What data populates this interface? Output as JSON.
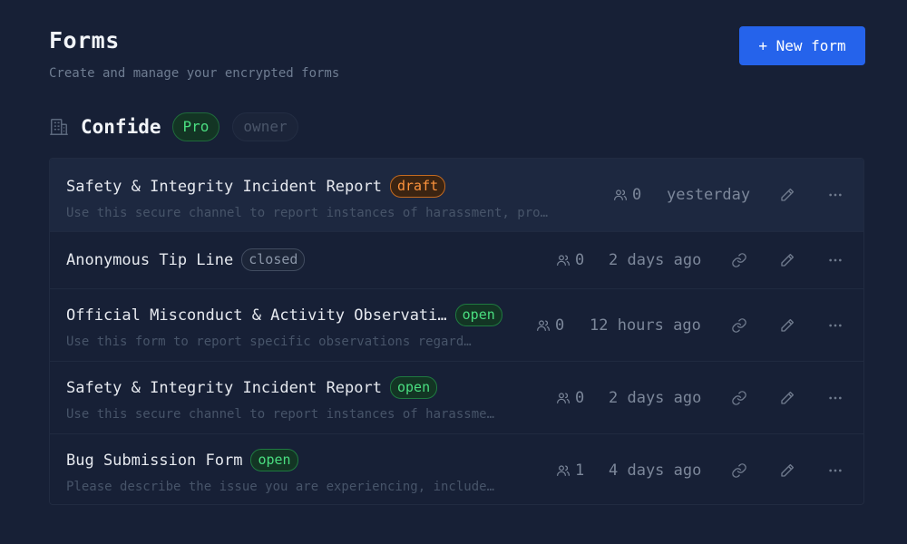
{
  "header": {
    "title": "Forms",
    "subtitle": "Create and manage your encrypted forms",
    "new_button_label": "+ New form"
  },
  "org": {
    "icon": "building-icon",
    "name": "Confide",
    "plan": "Pro",
    "role": "owner"
  },
  "forms": [
    {
      "title": "Safety & Integrity Incident Report",
      "status": "draft",
      "description": "Use this secure channel to report instances of harassment, pro…",
      "responses": "0",
      "updated": "yesterday"
    },
    {
      "title": "Anonymous Tip Line",
      "status": "closed",
      "description": "",
      "responses": "0",
      "updated": "2 days ago"
    },
    {
      "title": "Official Misconduct & Activity Observati…",
      "status": "open",
      "description": "Use this form to report specific observations regard…",
      "responses": "0",
      "updated": "12 hours ago"
    },
    {
      "title": "Safety & Integrity Incident Report",
      "status": "open",
      "description": "Use this secure channel to report instances of harassme…",
      "responses": "0",
      "updated": "2 days ago"
    },
    {
      "title": "Bug Submission Form",
      "status": "open",
      "description": "Please describe the issue you are experiencing, include…",
      "responses": "1",
      "updated": "4 days ago"
    }
  ],
  "icons": {
    "responses": "users-icon",
    "copy_link": "link-icon",
    "edit": "pencil-icon",
    "more": "more-icon"
  },
  "colors": {
    "background": "#172036",
    "accent": "#2563eb",
    "draft": "#fb923c",
    "open": "#4ade80",
    "closed": "#8a95a7"
  }
}
